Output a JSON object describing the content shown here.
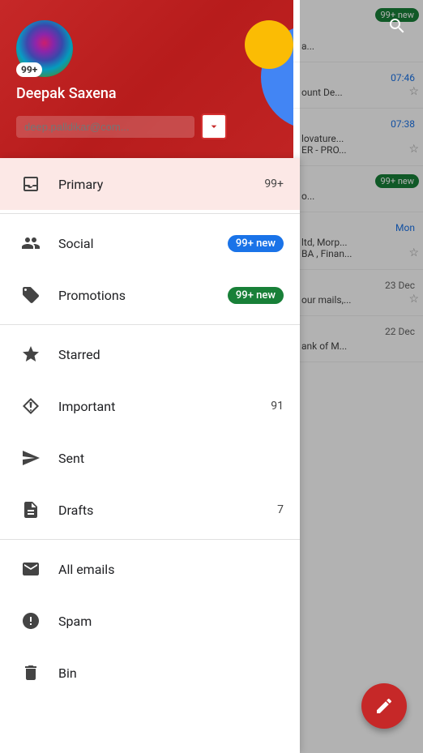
{
  "header": {
    "search_icon": "🔍",
    "badge_count": "99+",
    "user_name": "Deepak Saxena",
    "email_placeholder": "deep.palldikar@com...",
    "dropdown_arrow": "▼"
  },
  "sidebar": {
    "items": [
      {
        "id": "primary",
        "label": "Primary",
        "count": "99+",
        "badge": null,
        "active": true
      },
      {
        "id": "social",
        "label": "Social",
        "count": null,
        "badge": "99+ new",
        "badge_type": "blue",
        "active": false
      },
      {
        "id": "promotions",
        "label": "Promotions",
        "count": null,
        "badge": "99+ new",
        "badge_type": "green",
        "active": false
      },
      {
        "id": "starred",
        "label": "Starred",
        "count": null,
        "badge": null,
        "active": false
      },
      {
        "id": "important",
        "label": "Important",
        "count": "91",
        "badge": null,
        "active": false
      },
      {
        "id": "sent",
        "label": "Sent",
        "count": null,
        "badge": null,
        "active": false
      },
      {
        "id": "drafts",
        "label": "Drafts",
        "count": "7",
        "badge": null,
        "active": false
      },
      {
        "id": "all_emails",
        "label": "All emails",
        "count": null,
        "badge": null,
        "active": false
      },
      {
        "id": "spam",
        "label": "Spam",
        "count": null,
        "badge": null,
        "active": false
      },
      {
        "id": "bin",
        "label": "Bin",
        "count": null,
        "badge": null,
        "active": false
      }
    ]
  },
  "email_list": {
    "items": [
      {
        "id": "e1",
        "time": "07:46",
        "time_color": "blue",
        "snippet": "ount De...",
        "badge": "99+ new",
        "star": true
      },
      {
        "id": "e2",
        "time": "07:38",
        "time_color": "blue",
        "snippet": "lovature...",
        "sub": "ER - PRO...",
        "star": true
      },
      {
        "id": "e3",
        "time": "",
        "time_color": "blue",
        "snippet": "o...",
        "badge": "99+ new"
      },
      {
        "id": "e4",
        "time": "Mon",
        "time_color": "blue",
        "snippet": "ltd, Morp...",
        "sub": "BA , Finan...",
        "star": true
      },
      {
        "id": "e5",
        "time": "23 Dec",
        "time_color": "gray",
        "snippet": "our mails,...",
        "star": true
      },
      {
        "id": "e6",
        "time": "22 Dec",
        "time_color": "gray",
        "snippet": "ank of M..."
      }
    ]
  },
  "fab": {
    "icon": "✏",
    "label": "Compose"
  }
}
